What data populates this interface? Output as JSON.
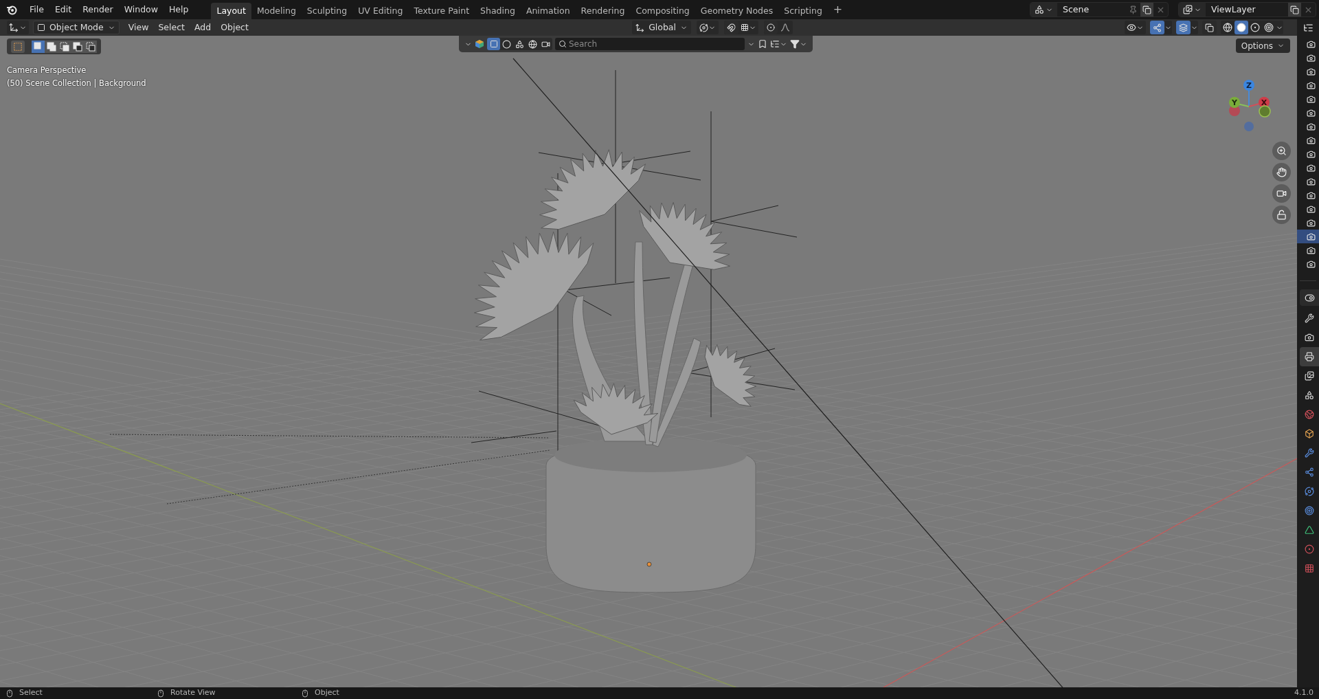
{
  "top_menu": [
    "File",
    "Edit",
    "Render",
    "Window",
    "Help"
  ],
  "workspace_tabs": [
    {
      "label": "Layout",
      "selected": true
    },
    {
      "label": "Modeling",
      "selected": false
    },
    {
      "label": "Sculpting",
      "selected": false
    },
    {
      "label": "UV Editing",
      "selected": false
    },
    {
      "label": "Texture Paint",
      "selected": false
    },
    {
      "label": "Shading",
      "selected": false
    },
    {
      "label": "Animation",
      "selected": false
    },
    {
      "label": "Rendering",
      "selected": false
    },
    {
      "label": "Compositing",
      "selected": false
    },
    {
      "label": "Geometry Nodes",
      "selected": false
    },
    {
      "label": "Scripting",
      "selected": false
    }
  ],
  "add_workspace": "+",
  "scene_selector": {
    "name": "Scene"
  },
  "view_layer_selector": {
    "name": "ViewLayer"
  },
  "viewport_header": {
    "mode": "Object Mode",
    "menus": [
      "View",
      "Select",
      "Add",
      "Object"
    ],
    "orientation": "Global",
    "snap_on": false,
    "proportional_on": false,
    "gizmos_on": true,
    "overlays_on": true,
    "xray_on": false,
    "shading_modes": [
      {
        "kind": "wireframe",
        "selected": false
      },
      {
        "kind": "solid",
        "selected": true
      },
      {
        "kind": "material",
        "selected": false
      },
      {
        "kind": "rendered",
        "selected": false
      }
    ]
  },
  "tool_settings": {
    "select_modes": [
      {
        "kind": "set",
        "selected": true
      },
      {
        "kind": "extend",
        "selected": false
      },
      {
        "kind": "subtract",
        "selected": false
      },
      {
        "kind": "difference",
        "selected": false
      },
      {
        "kind": "intersect",
        "selected": false
      }
    ]
  },
  "filter_bar": {
    "search": {
      "placeholder": "Search"
    }
  },
  "options_button": "Options",
  "viewport_info": [
    "Camera Perspective",
    "(50) Scene Collection | Background"
  ],
  "axis_labels": [
    "Z",
    "Y",
    "X"
  ],
  "outliner_rows": [
    {
      "selected": false
    },
    {
      "selected": false
    },
    {
      "selected": false
    },
    {
      "selected": false
    },
    {
      "selected": false
    },
    {
      "selected": false
    },
    {
      "selected": false
    },
    {
      "selected": false
    },
    {
      "selected": false
    },
    {
      "selected": false
    },
    {
      "selected": false
    },
    {
      "selected": false
    },
    {
      "selected": false
    },
    {
      "selected": false
    },
    {
      "selected": true
    },
    {
      "selected": false
    },
    {
      "selected": false
    }
  ],
  "properties_tabs": [
    {
      "kind": "tool",
      "selected": false
    },
    {
      "kind": "render",
      "selected": false
    },
    {
      "kind": "output",
      "selected": true
    },
    {
      "kind": "view_layer",
      "selected": false
    },
    {
      "kind": "scene",
      "selected": false
    },
    {
      "kind": "world",
      "selected": false
    },
    {
      "kind": "object",
      "selected": false
    },
    {
      "kind": "modifiers",
      "selected": false
    },
    {
      "kind": "particles",
      "selected": false
    },
    {
      "kind": "physics",
      "selected": false
    },
    {
      "kind": "constraints",
      "selected": false
    },
    {
      "kind": "data",
      "selected": false
    },
    {
      "kind": "material",
      "selected": false
    },
    {
      "kind": "texture",
      "selected": false
    }
  ],
  "status_bar": {
    "hints": [
      {
        "kind": "left_click",
        "label": "Select"
      },
      {
        "kind": "middle_click",
        "label": "Rotate View"
      },
      {
        "kind": "right_click",
        "label": "Object"
      }
    ],
    "version": "4.1.0"
  }
}
